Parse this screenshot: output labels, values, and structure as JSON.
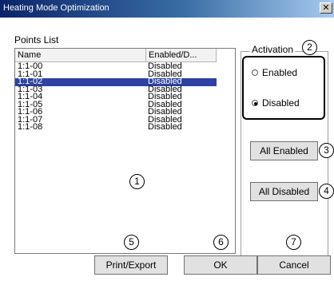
{
  "window": {
    "title": "Heating Mode Optimization",
    "close_glyph": "✕"
  },
  "points": {
    "label": "Points List",
    "columns": [
      "Name",
      "Enabled/D..."
    ],
    "rows": [
      {
        "name": "1:1-00",
        "status": "Disabled"
      },
      {
        "name": "1:1-01",
        "status": "Disabled"
      },
      {
        "name": "1:1-02",
        "status": "Disabled"
      },
      {
        "name": "1:1-03",
        "status": "Disabled"
      },
      {
        "name": "1:1-04",
        "status": "Disabled"
      },
      {
        "name": "1:1-05",
        "status": "Disabled"
      },
      {
        "name": "1:1-06",
        "status": "Disabled"
      },
      {
        "name": "1:1-07",
        "status": "Disabled"
      },
      {
        "name": "1:1-08",
        "status": "Disabled"
      }
    ],
    "selected_index": 2
  },
  "activation": {
    "legend": "Activation",
    "options": [
      "Enabled",
      "Disabled"
    ],
    "selected": "Disabled"
  },
  "buttons": {
    "all_enabled": "All Enabled",
    "all_disabled": "All Disabled",
    "print_export": "Print/Export",
    "ok": "OK",
    "cancel": "Cancel"
  },
  "callouts": [
    "1",
    "2",
    "3",
    "4",
    "5",
    "6",
    "7"
  ],
  "colors": {
    "selection": "#2d42a3",
    "titlebar": "#0a246a"
  }
}
